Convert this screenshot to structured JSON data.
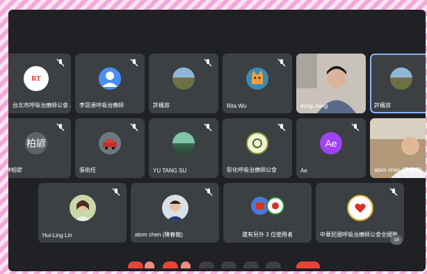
{
  "participants": [
    {
      "name": "台北市呼吸治療師公會...",
      "avatar": "logo-rt",
      "avatar_text": "RT"
    },
    {
      "name": "李昆達呼吸治療師",
      "avatar": "default-person-icon"
    },
    {
      "name": "許楓容",
      "avatar": "photo-landscape"
    },
    {
      "name": "Rita Wu",
      "avatar": "photo-cat"
    },
    {
      "name": "dong Jiang",
      "avatar": "video-feed"
    },
    {
      "name": "許楓容",
      "avatar": "photo-landscape"
    },
    {
      "name": "林柏諺",
      "avatar": "initials",
      "avatar_text": "柏諺"
    },
    {
      "name": "張佑任",
      "avatar": "photo-red-car"
    },
    {
      "name": "YU TANG SU",
      "avatar": "photo-mountains"
    },
    {
      "name": "彰化呼吸治療師公會",
      "avatar": "logo-seal"
    },
    {
      "name": "Ae",
      "avatar": "initials",
      "avatar_text": "Ae"
    },
    {
      "name": "atom chen (陳春龍)",
      "avatar": "video-feed"
    },
    {
      "name": "Hui-Ling Lin",
      "avatar": "photo-woman"
    },
    {
      "name": "atom chen (陳春龍)",
      "avatar": "photo-man"
    },
    {
      "name": "還有另外 3 位使用者",
      "avatar": "group-avatars"
    },
    {
      "name": "中華民國呼吸治療師公會全國聯...",
      "avatar": "logo-heart"
    }
  ],
  "participant_count": "18",
  "colors": {
    "tile": "#3c4043",
    "background": "#202124",
    "active_border": "#8ab4f8",
    "hangup": "#ea4335",
    "initials_ae": "#a142f4"
  }
}
